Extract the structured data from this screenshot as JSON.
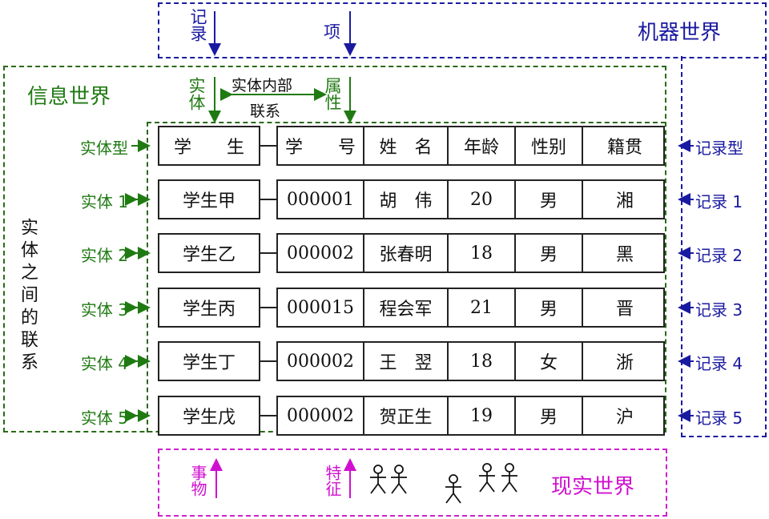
{
  "worlds": {
    "machine": "机器世界",
    "info": "信息世界",
    "real": "现实世界"
  },
  "machine_labels": {
    "record": "记录",
    "item": "项"
  },
  "info_labels": {
    "entity": "实体",
    "internal_link_top": "实体内部",
    "internal_link_bottom": "联系",
    "attribute": "属性",
    "between_entities": "实体之间的联系"
  },
  "real_labels": {
    "thing": "事物",
    "feature": "特征"
  },
  "left_tags": [
    "实体型",
    "实体 1",
    "实体 2",
    "实体 3",
    "实体 4",
    "实体 5"
  ],
  "right_tags": [
    "记录型",
    "记录 1",
    "记录 2",
    "记录 3",
    "记录 4",
    "记录 5"
  ],
  "entity_names": [
    "学　　生",
    "学生甲",
    "学生乙",
    "学生丙",
    "学生丁",
    "学生戊"
  ],
  "columns": [
    "学　　号",
    "姓　名",
    "年龄",
    "性别",
    "籍贯"
  ],
  "rows": [
    [
      "000001",
      "胡　伟",
      "20",
      "男",
      "湘"
    ],
    [
      "000002",
      "张春明",
      "18",
      "男",
      "黑"
    ],
    [
      "000015",
      "程会军",
      "21",
      "男",
      "晋"
    ],
    [
      "000002",
      "王　翌",
      "18",
      "女",
      "浙"
    ],
    [
      "000002",
      "贺正生",
      "19",
      "男",
      "沪"
    ]
  ],
  "colors": {
    "machine": "#1a1aa0",
    "info": "#1f7a12",
    "real": "#d010d0"
  }
}
